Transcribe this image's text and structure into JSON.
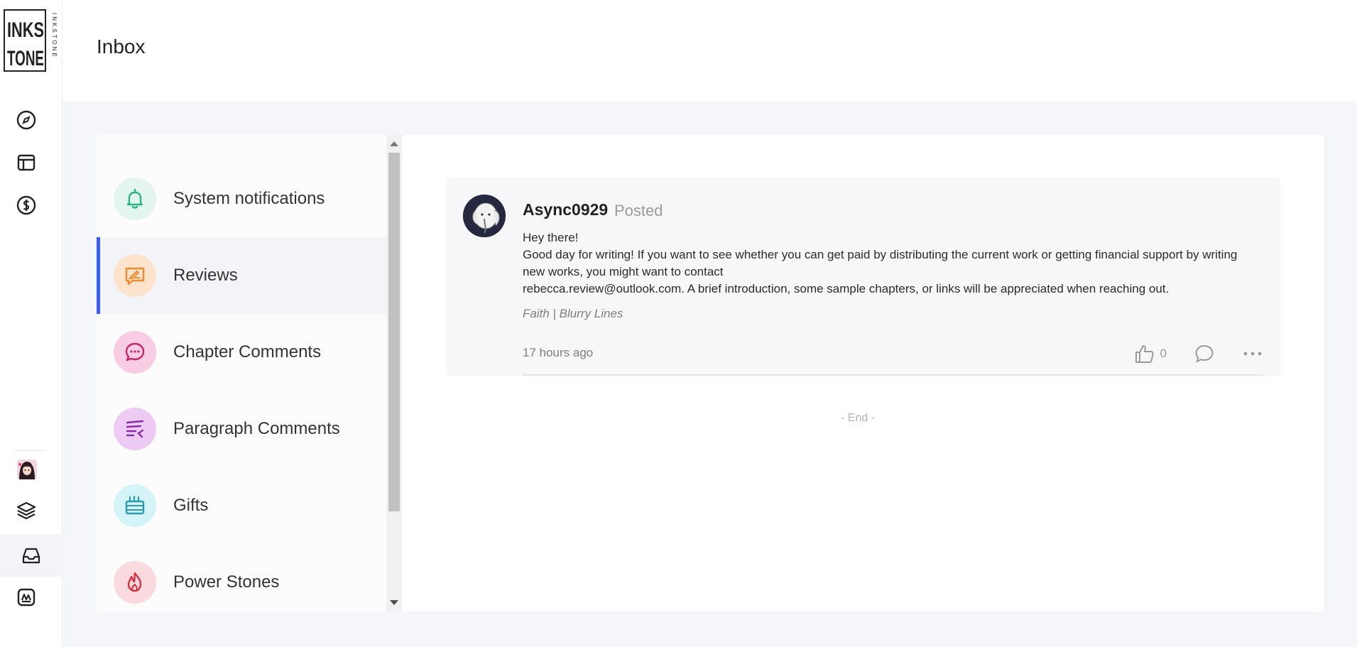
{
  "app": {
    "logo_text": "INKSTONE",
    "logo_letters": {
      "top": "INKS",
      "bottom": "TONE",
      "side": "INKSTONE"
    }
  },
  "header": {
    "title": "Inbox"
  },
  "rail": {
    "items": [
      {
        "icon": "compass-icon"
      },
      {
        "icon": "dashboard-icon"
      },
      {
        "icon": "dollar-coin-icon"
      },
      {
        "icon": "user-avatar"
      },
      {
        "icon": "layers-icon"
      },
      {
        "icon": "inbox-icon",
        "active": true
      },
      {
        "icon": "image-icon"
      }
    ]
  },
  "categories": [
    {
      "label": "System notifications",
      "icon": "bell-icon",
      "bg": "#e2f5ef",
      "color": "#2ab488"
    },
    {
      "label": "Reviews",
      "icon": "review-icon",
      "bg": "#fde2cc",
      "color": "#f08a2a",
      "active": true
    },
    {
      "label": "Chapter Comments",
      "icon": "chat-bubble-icon",
      "bg": "#f8cde3",
      "color": "#c6246b"
    },
    {
      "label": "Paragraph Comments",
      "icon": "paragraph-comment-icon",
      "bg": "#eecbf5",
      "color": "#8a2ea8"
    },
    {
      "label": "Gifts",
      "icon": "gift-icon",
      "bg": "#d4f4f8",
      "color": "#2a9bb0"
    },
    {
      "label": "Power Stones",
      "icon": "flame-icon",
      "bg": "#fbdadf",
      "color": "#d4303f"
    }
  ],
  "message": {
    "author": "Async0929",
    "action": "Posted",
    "body_line1": "Hey there!",
    "body_line2": "Good day for writing! If you want to see whether you can get paid by distributing the current work or getting financial support by writing new works, you might want to contact",
    "body_line3": "rebecca.review@outlook.com. A brief introduction, some sample chapters, or links will be appreciated when reaching out.",
    "source": "Faith | Blurry Lines",
    "time": "17 hours ago",
    "likes": "0"
  },
  "end_text": "- End -",
  "colors": {
    "accent": "#3b5cf5"
  }
}
